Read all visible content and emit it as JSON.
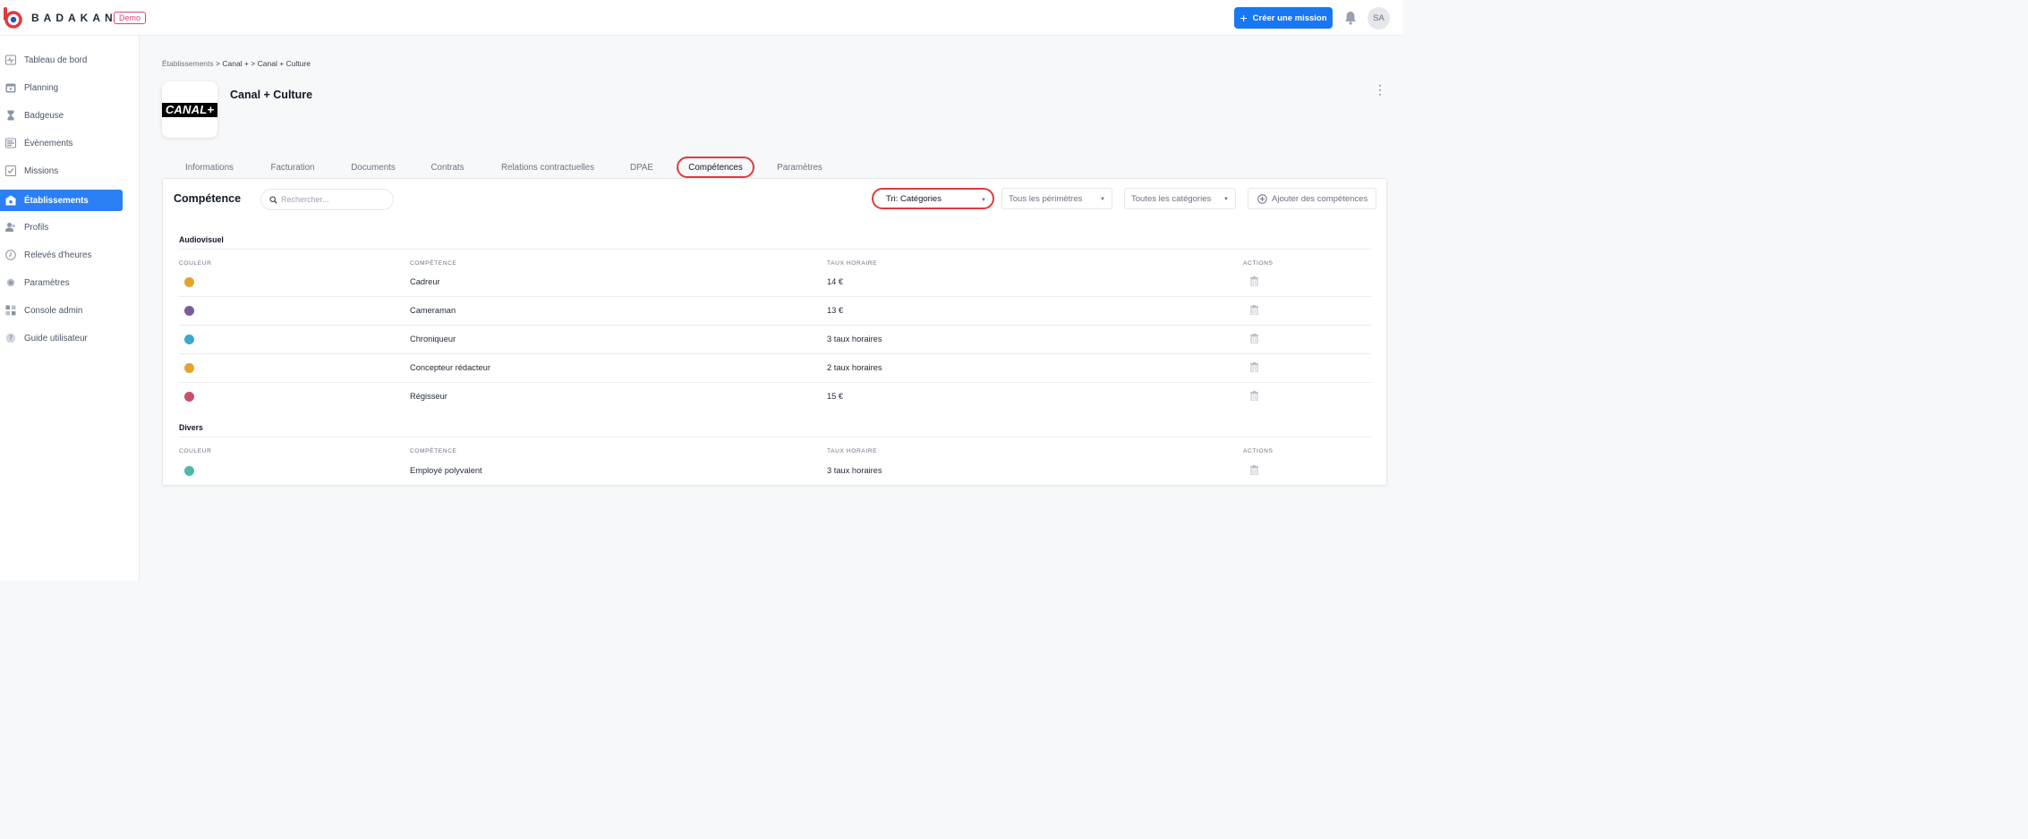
{
  "app": {
    "name": "BADAKAN",
    "badge": "Demo"
  },
  "header": {
    "create_label": "Créer une mission",
    "avatar_initials": "SA"
  },
  "sidebar": {
    "items": [
      {
        "label": "Tableau de bord",
        "icon": "pulse-icon"
      },
      {
        "label": "Planning",
        "icon": "calendar-icon"
      },
      {
        "label": "Badgeuse",
        "icon": "hourglass-icon"
      },
      {
        "label": "Évènements",
        "icon": "events-list-icon"
      },
      {
        "label": "Missions",
        "icon": "checklist-icon"
      },
      {
        "label": "Établissements",
        "icon": "building-icon",
        "active": true
      },
      {
        "label": "Profils",
        "icon": "users-icon"
      },
      {
        "label": "Relevés d'heures",
        "icon": "clock-icon"
      },
      {
        "label": "Paramètres",
        "icon": "gear-icon"
      },
      {
        "label": "Console admin",
        "icon": "grid-icon"
      },
      {
        "label": "Guide utilisateur",
        "icon": "help-icon"
      }
    ]
  },
  "breadcrumb": {
    "part1": "Établissements",
    "sep": ">",
    "part2": "Canal +",
    "part3": "Canal + Culture"
  },
  "establishment": {
    "logo_text": "CANAL+",
    "name": "Canal + Culture"
  },
  "tabs": [
    {
      "label": "Informations"
    },
    {
      "label": "Facturation"
    },
    {
      "label": "Documents"
    },
    {
      "label": "Contrats"
    },
    {
      "label": "Relations contractuelles"
    },
    {
      "label": "DPAE"
    },
    {
      "label": "Compétences",
      "active": true
    },
    {
      "label": "Paramètres"
    }
  ],
  "panel": {
    "title": "Compétence",
    "search_placeholder": "Rechercher...",
    "sort_select": "Tri: Catégories",
    "perimeter_select": "Tous les périmètres",
    "category_select": "Toutes les catégories",
    "add_label": "Ajouter des compétences"
  },
  "columns": {
    "color": "COULEUR",
    "skill": "COMPÉTENCE",
    "rate": "TAUX HORAIRE",
    "actions": "ACTIONS"
  },
  "groups": [
    {
      "name": "Audiovisuel",
      "rows": [
        {
          "color": "#e5a32c",
          "skill": "Cadreur",
          "rate": "14 €"
        },
        {
          "color": "#7a5c9c",
          "skill": "Cameraman",
          "rate": "13 €"
        },
        {
          "color": "#3ba9cd",
          "skill": "Chroniqueur",
          "rate": "3 taux horaires"
        },
        {
          "color": "#e5a32c",
          "skill": "Concepteur rédacteur",
          "rate": "2 taux horaires"
        },
        {
          "color": "#c94f6d",
          "skill": "Régisseur",
          "rate": "15 €"
        }
      ]
    },
    {
      "name": "Divers",
      "rows": [
        {
          "color": "#4bb8a9",
          "skill": "Employé polyvalent",
          "rate": "3 taux horaires"
        }
      ]
    }
  ],
  "colors": {
    "accent": "#1877f2",
    "sidebar_active": "#2a7ff5",
    "highlight": "#e03a3e",
    "demo_badge": "#e0457b"
  }
}
